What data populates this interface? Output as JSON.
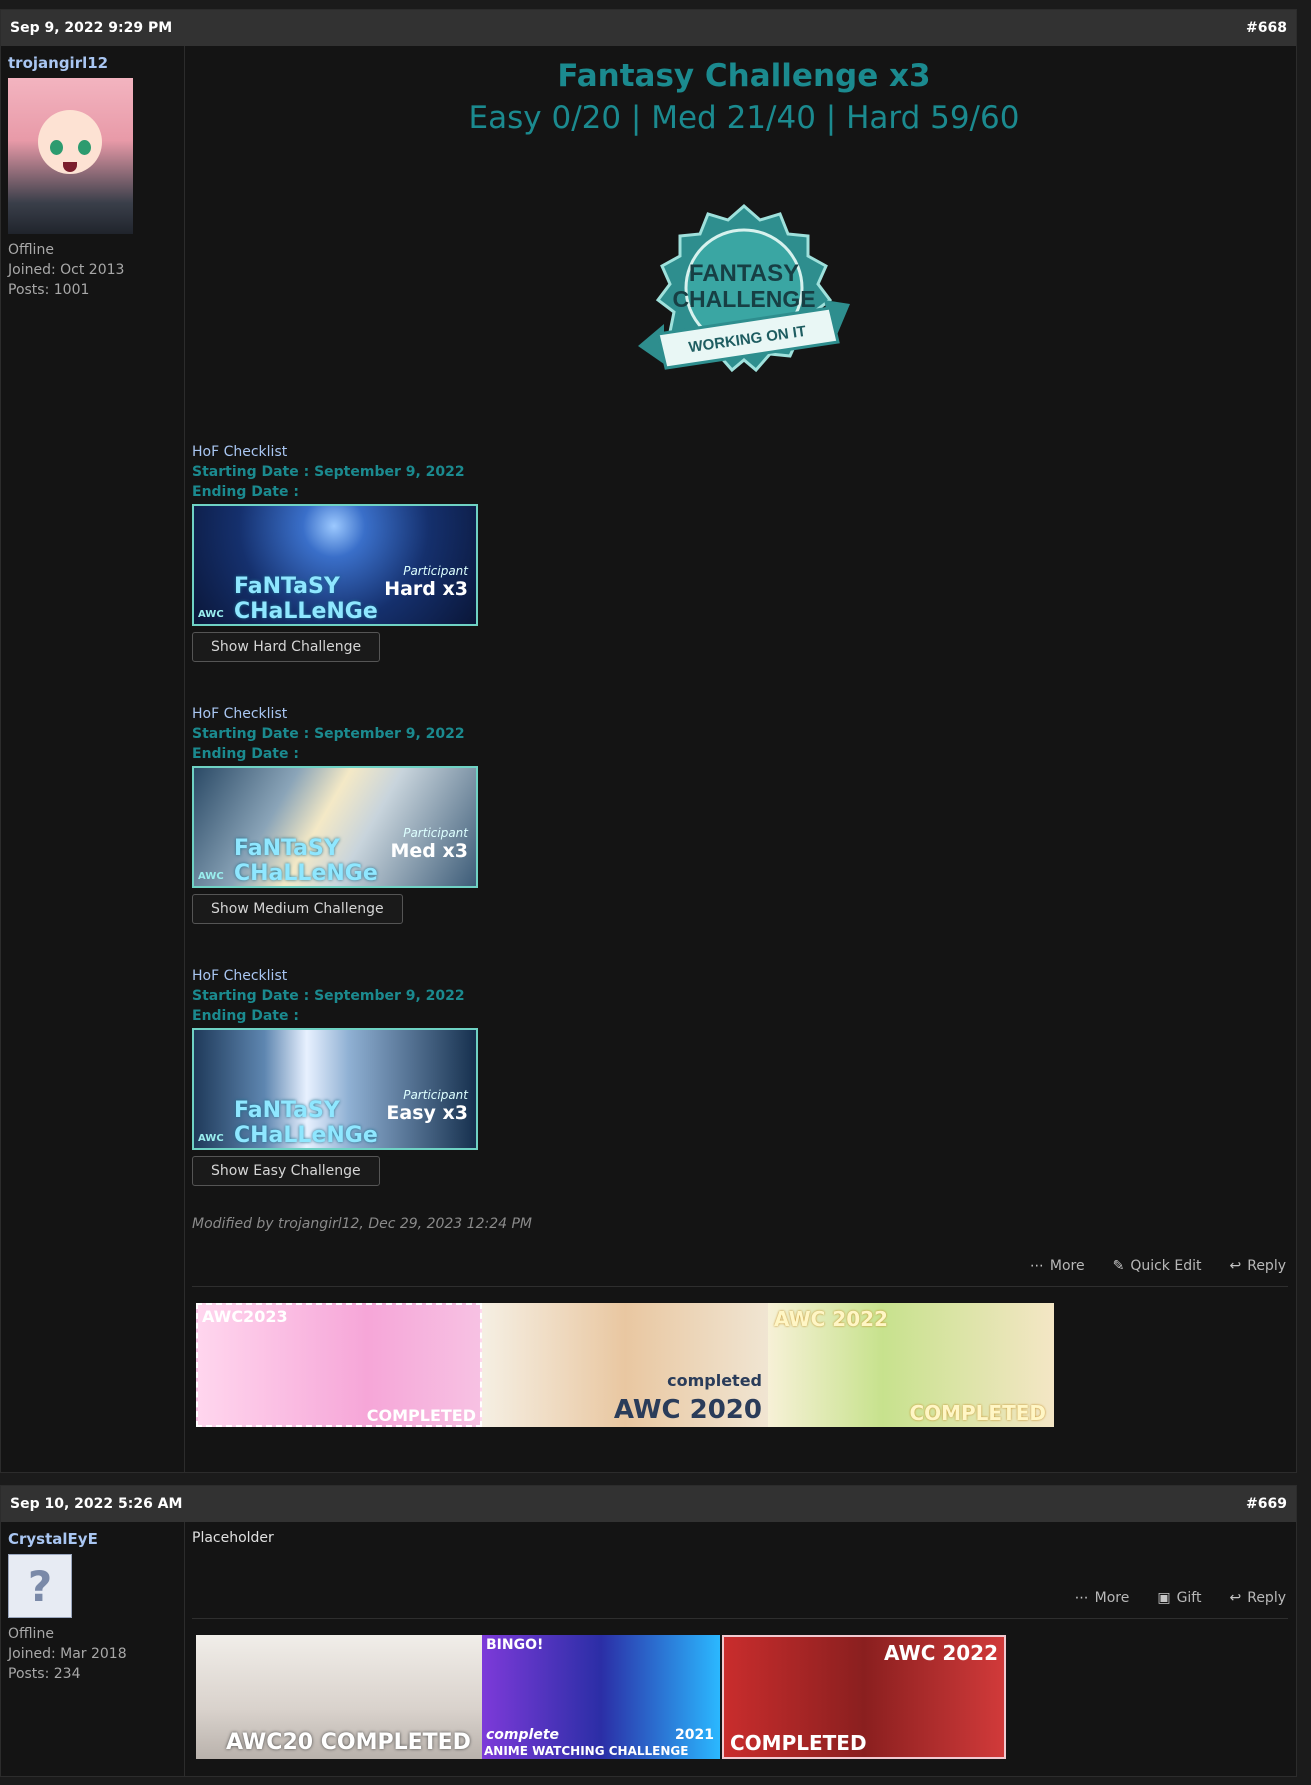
{
  "posts": [
    {
      "date": "Sep 9, 2022 9:29 PM",
      "number": "#668",
      "user": {
        "name": "trojangirl12",
        "status": "Offline",
        "joined": "Joined: Oct 2013",
        "posts": "Posts: 1001"
      },
      "title": "Fantasy Challenge x3",
      "subtitle": "Easy 0/20 | Med 21/40 | Hard 59/60",
      "badge": {
        "line1": "FANTASY",
        "line2": "CHALLENGE",
        "ribbon": "WORKING ON IT"
      },
      "sections": [
        {
          "checklist": "HoF Checklist",
          "start": "Starting Date : September 9, 2022",
          "end": "Ending Date :",
          "banner_participant": "Participant",
          "banner_level": "Hard x3",
          "banner_title": "FaNTaSY CHaLLeNGe",
          "banner_awc": "AWC",
          "button": "Show Hard Challenge"
        },
        {
          "checklist": "HoF Checklist",
          "start": "Starting Date : September 9, 2022",
          "end": "Ending Date :",
          "banner_participant": "Participant",
          "banner_level": "Med x3",
          "banner_title": "FaNTaSY CHaLLeNGe",
          "banner_awc": "AWC",
          "button": "Show Medium Challenge"
        },
        {
          "checklist": "HoF Checklist",
          "start": "Starting Date : September 9, 2022",
          "end": "Ending Date :",
          "banner_participant": "Participant",
          "banner_level": "Easy x3",
          "banner_title": "FaNTaSY CHaLLeNGe",
          "banner_awc": "AWC",
          "button": "Show Easy Challenge"
        }
      ],
      "modified": "Modified by trojangirl12, Dec 29, 2023 12:24 PM",
      "actions": {
        "more": "More",
        "quick_edit": "Quick Edit",
        "reply": "Reply"
      },
      "signature": [
        {
          "top": "AWC2023",
          "bottom": "COMPLETED"
        },
        {
          "top": "completed",
          "bottom": "AWC 2020"
        },
        {
          "top": "AWC 2022",
          "bottom": "COMPLETED"
        }
      ]
    },
    {
      "date": "Sep 10, 2022 5:26 AM",
      "number": "#669",
      "user": {
        "name": "CrystalEyE",
        "status": "Offline",
        "joined": "Joined: Mar 2018",
        "posts": "Posts: 234"
      },
      "body": "Placeholder",
      "actions": {
        "more": "More",
        "gift": "Gift",
        "reply": "Reply"
      },
      "signature": [
        {
          "bottom": "AWC20 COMPLETED"
        },
        {
          "top": "BINGO!",
          "mid": "complete",
          "year": "2021",
          "bottom": "ANIME WATCHING CHALLENGE"
        },
        {
          "top": "AWC 2022",
          "bottom": "COMPLETED"
        }
      ]
    }
  ],
  "colors": {
    "accent": "#1b8a8f",
    "username": "#a9c6f2",
    "header_bg": "#323232",
    "post_bg": "#141414"
  }
}
